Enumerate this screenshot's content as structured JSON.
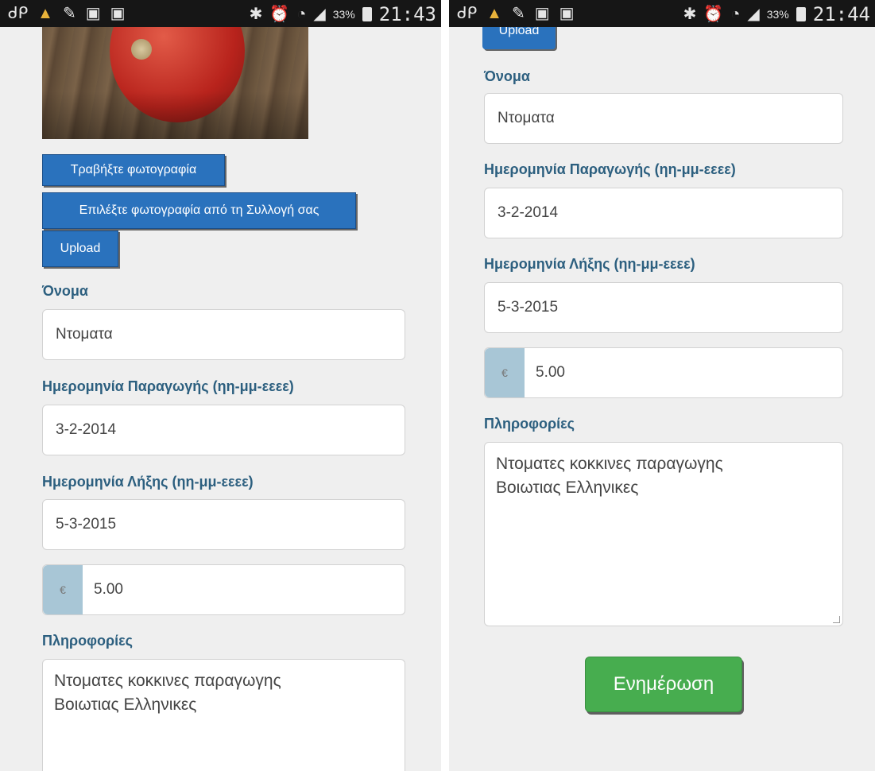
{
  "status_bar": {
    "left_icons": [
      "cp-icon",
      "broom-icon",
      "pencil-icon",
      "briefcase-icon",
      "briefcase-check-icon"
    ],
    "battery_percent": "33%",
    "left_time": "21:43",
    "right_time": "21:44"
  },
  "photo_buttons": {
    "take_photo": "Τραβήξτε φωτογραφία",
    "choose_from_gallery": "Επιλέξτε φωτογραφία από τη Συλλογή σας",
    "upload": "Upload"
  },
  "form": {
    "name_label": "Όνομα",
    "name_value": "Ντοματα",
    "production_date_label": "Ημερομηνία Παραγωγής (ηη-μμ-εεεε)",
    "production_date_value": "3-2-2014",
    "expiry_date_label": "Ημερομηνία Λήξης (ηη-μμ-εεεε)",
    "expiry_date_value": "5-3-2015",
    "currency_symbol": "€",
    "price_value": "5.00",
    "info_label": "Πληροφορίες",
    "info_line1": "Ντοματες κοκκινες παραγωγης",
    "info_line2": "Βοιωτιας Ελληνικες"
  },
  "update_button": "Ενημέρωση",
  "colors": {
    "primary_blue": "#2a72bd",
    "label_teal": "#2c5f7f",
    "success_green": "#47ad4f",
    "addon_blue": "#a8c6d6"
  }
}
